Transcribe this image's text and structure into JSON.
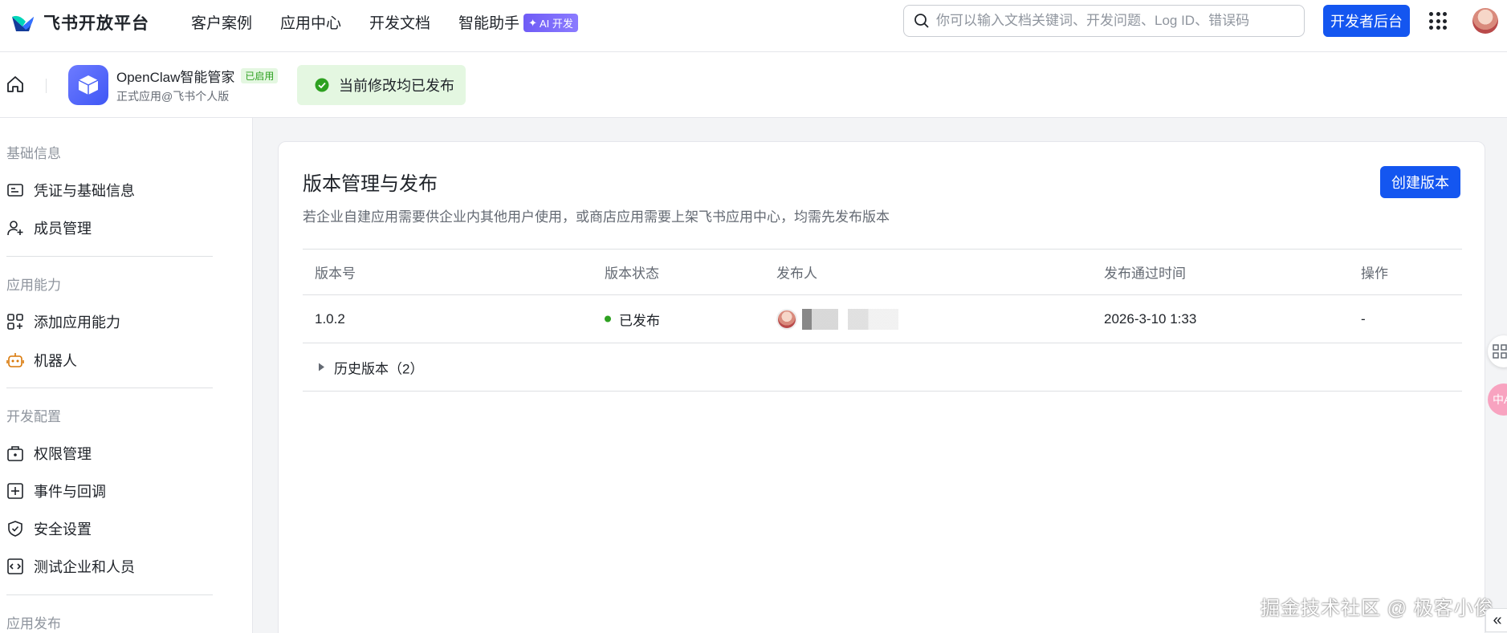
{
  "topbar": {
    "logo_text": "飞书开放平台",
    "nav": [
      "客户案例",
      "应用中心",
      "开发文档",
      "智能助手"
    ],
    "ai_badge": "AI 开发",
    "search_placeholder": "你可以输入文档关键词、开发问题、Log ID、错误码",
    "dev_console_label": "开发者后台"
  },
  "appbar": {
    "app_name": "OpenClaw智能管家",
    "status_badge": "已启用",
    "subtitle": "正式应用@飞书个人版",
    "publish_tip": "当前修改均已发布"
  },
  "sidebar": {
    "sections": [
      {
        "title": "基础信息",
        "items": [
          "凭证与基础信息",
          "成员管理"
        ]
      },
      {
        "title": "应用能力",
        "items": [
          "添加应用能力",
          "机器人"
        ]
      },
      {
        "title": "开发配置",
        "items": [
          "权限管理",
          "事件与回调",
          "安全设置",
          "测试企业和人员"
        ]
      },
      {
        "title": "应用发布",
        "items": []
      }
    ]
  },
  "main": {
    "title": "版本管理与发布",
    "description": "若企业自建应用需要供企业内其他用户使用，或商店应用需要上架飞书应用中心，均需先发布版本",
    "create_button": "创建版本",
    "columns": [
      "版本号",
      "版本状态",
      "发布人",
      "发布通过时间",
      "操作"
    ],
    "rows": [
      {
        "version": "1.0.2",
        "status": "已发布",
        "publisher": "",
        "time": "2026-3-10 1:33",
        "action": "-"
      }
    ],
    "history_label": "历史版本（2）"
  },
  "float": {
    "translate_label": "中A"
  },
  "watermark": "掘金技术社区 @ 极客小俊",
  "colors": {
    "primary": "#1456f0",
    "success": "#2ea121",
    "success_bg": "#e4f7e1",
    "ai_purple": "#6f5cf6"
  }
}
